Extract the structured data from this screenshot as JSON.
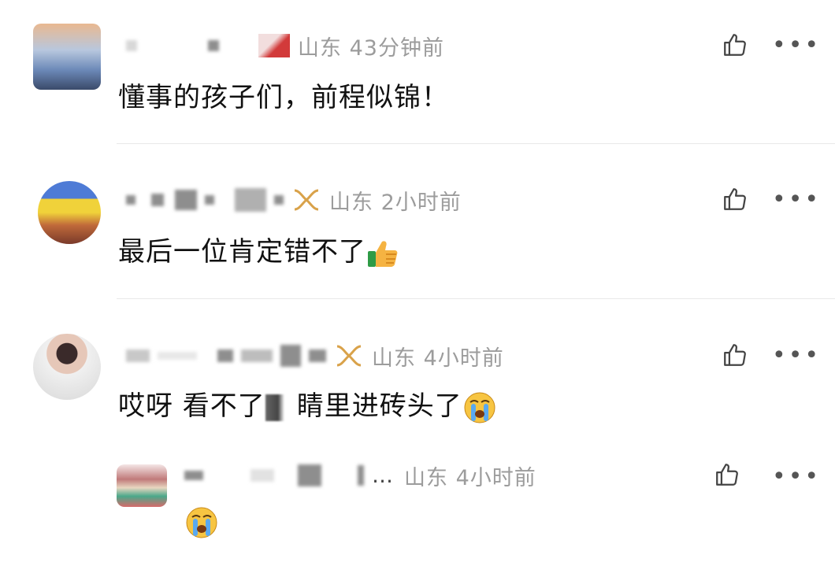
{
  "comments": [
    {
      "location_time": "山东 43分钟前",
      "text": "懂事的孩子们，前程似锦！"
    },
    {
      "location_time": "山东 2小时前",
      "text": "最后一位肯定错不了"
    },
    {
      "location_time": "山东 4小时前",
      "text_part1": "哎呀 看不了",
      "text_part2": "睛里进砖头了"
    },
    {
      "location_time": "山东 4小时前",
      "reply": true
    }
  ],
  "icons": {
    "like": "thumbs-up-outline-icon",
    "more": "more-dots-icon",
    "emoji_thumbs": "thumbs-up-emoji",
    "emoji_cry": "crying-face-emoji"
  },
  "colors": {
    "meta_gray": "#9c9c9c",
    "text": "#111111",
    "badge_gold": "#d9a24a"
  }
}
